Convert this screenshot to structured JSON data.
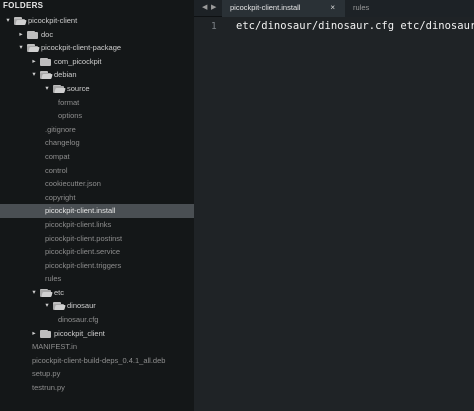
{
  "sidebar": {
    "header": "FOLDERS",
    "tree": [
      {
        "label": "picockpit-client",
        "kind": "folder-open",
        "depth": 0,
        "selected": false
      },
      {
        "label": "doc",
        "kind": "folder-closed",
        "depth": 1,
        "selected": false
      },
      {
        "label": "picockpit-client-package",
        "kind": "folder-open",
        "depth": 1,
        "selected": false
      },
      {
        "label": "com_picockpit",
        "kind": "folder-closed",
        "depth": 2,
        "selected": false
      },
      {
        "label": "debian",
        "kind": "folder-open",
        "depth": 2,
        "selected": false
      },
      {
        "label": "source",
        "kind": "folder-open",
        "depth": 3,
        "selected": false
      },
      {
        "label": "format",
        "kind": "file",
        "depth": 4,
        "selected": false
      },
      {
        "label": "options",
        "kind": "file",
        "depth": 4,
        "selected": false
      },
      {
        "label": ".gitignore",
        "kind": "file",
        "depth": 3,
        "selected": false
      },
      {
        "label": "changelog",
        "kind": "file",
        "depth": 3,
        "selected": false
      },
      {
        "label": "compat",
        "kind": "file",
        "depth": 3,
        "selected": false
      },
      {
        "label": "control",
        "kind": "file",
        "depth": 3,
        "selected": false
      },
      {
        "label": "cookiecutter.json",
        "kind": "file",
        "depth": 3,
        "selected": false
      },
      {
        "label": "copyright",
        "kind": "file",
        "depth": 3,
        "selected": false
      },
      {
        "label": "picockpit-client.install",
        "kind": "file",
        "depth": 3,
        "selected": true
      },
      {
        "label": "picockpit-client.links",
        "kind": "file",
        "depth": 3,
        "selected": false
      },
      {
        "label": "picockpit-client.postinst",
        "kind": "file",
        "depth": 3,
        "selected": false
      },
      {
        "label": "picockpit-client.service",
        "kind": "file",
        "depth": 3,
        "selected": false
      },
      {
        "label": "picockpit-client.triggers",
        "kind": "file",
        "depth": 3,
        "selected": false
      },
      {
        "label": "rules",
        "kind": "file",
        "depth": 3,
        "selected": false
      },
      {
        "label": "etc",
        "kind": "folder-open",
        "depth": 2,
        "selected": false
      },
      {
        "label": "dinosaur",
        "kind": "folder-open",
        "depth": 3,
        "selected": false
      },
      {
        "label": "dinosaur.cfg",
        "kind": "file",
        "depth": 4,
        "selected": false
      },
      {
        "label": "picockpit_client",
        "kind": "folder-closed",
        "depth": 2,
        "selected": false
      },
      {
        "label": "MANIFEST.in",
        "kind": "file",
        "depth": 2,
        "selected": false
      },
      {
        "label": "picockpit-client-build-deps_0.4.1_all.deb",
        "kind": "file",
        "depth": 2,
        "selected": false
      },
      {
        "label": "setup.py",
        "kind": "file",
        "depth": 2,
        "selected": false
      },
      {
        "label": "testrun.py",
        "kind": "file",
        "depth": 2,
        "selected": false
      }
    ]
  },
  "tabs": {
    "nav_back": "◀",
    "nav_forward": "▶",
    "active_label": "picockpit-client.install",
    "active_close": "×",
    "inactive_label": "rules"
  },
  "editor": {
    "line_number": "1",
    "line_text": "etc/dinosaur/dinosaur.cfg etc/dinosaur"
  },
  "colors": {
    "sidebar_bg": "#141718",
    "selected_bg": "#4a4f53",
    "editor_bg": "#1f2326",
    "tab_active_bg": "#2a3136"
  }
}
